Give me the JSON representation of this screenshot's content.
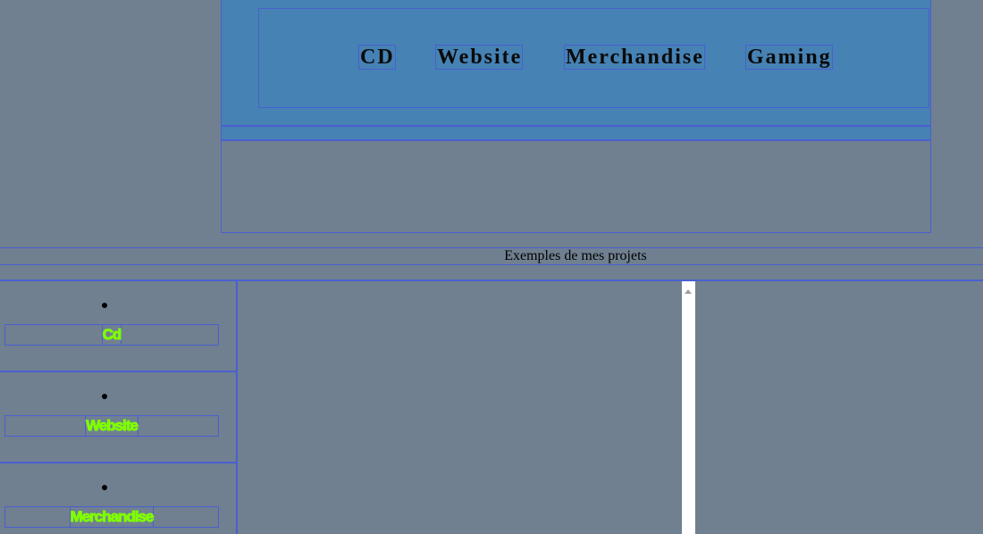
{
  "header": {
    "nav": [
      {
        "label": "CD"
      },
      {
        "label": "Website"
      },
      {
        "label": "Merchandise"
      },
      {
        "label": "Gaming"
      }
    ]
  },
  "section": {
    "title": "Exemples de mes projets"
  },
  "projects": [
    {
      "label": "Cd"
    },
    {
      "label": "Website"
    },
    {
      "label": "Merchandise"
    }
  ],
  "colors": {
    "background": "#708090",
    "banner": "#4682b4",
    "border": "#4a5fd0",
    "project_link": "#7fff00"
  },
  "icons": {
    "scroll_up": "chevron-up-icon"
  }
}
